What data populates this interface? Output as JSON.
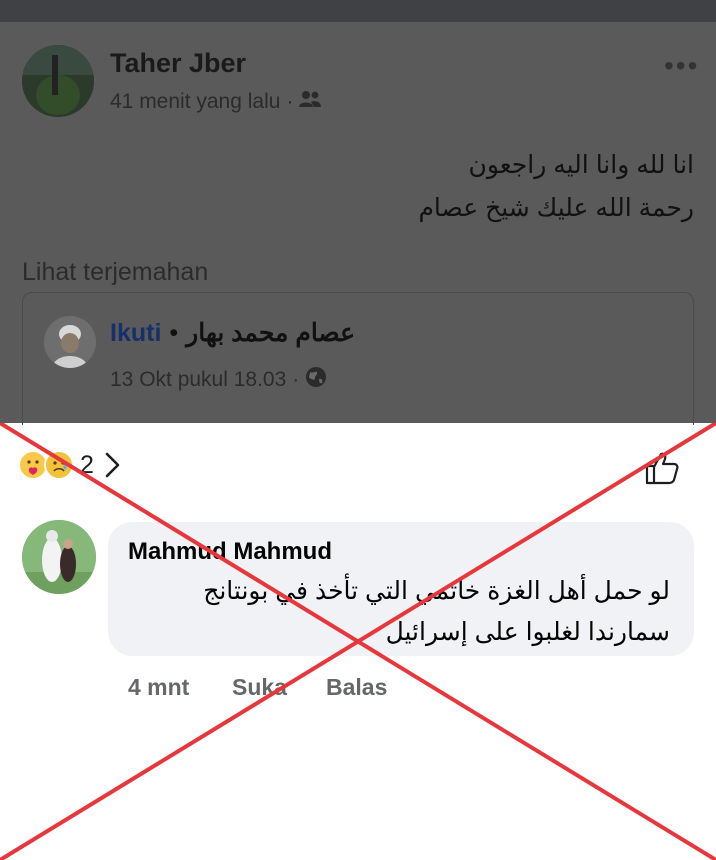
{
  "post": {
    "author": "Taher Jber",
    "time": "41 menit yang lalu",
    "time_sep": "·",
    "audience_icon": "friends-icon",
    "more_label": "•••",
    "text_line1": "انا لله وانا اليه راجعون",
    "text_line2": "رحمة الله عليك شيخ عصام",
    "translate_label": "Lihat terjemahan"
  },
  "shared": {
    "follow_label": "Ikuti",
    "separator": "•",
    "name": "عصام محمد بهار",
    "time": "13 Okt pukul 18.03",
    "time_sep": "·",
    "audience_icon": "globe-icon"
  },
  "reactions": {
    "icons": [
      "care-icon",
      "sad-icon"
    ],
    "count": "2",
    "chevron": "chevron-right-icon",
    "like_icon": "thumbs-up-icon"
  },
  "comment": {
    "author": "Mahmud Mahmud",
    "text_line1": "لو حمل أهل الغزة خاتمي التي تأخذ في بونتانج",
    "text_line2": "سمارندا لغلبوا على إسرائيل",
    "time": "4 mnt",
    "like_label": "Suka",
    "reply_label": "Balas"
  },
  "overlay": {
    "mark": "red-x-mark",
    "color": "#e8373c"
  }
}
